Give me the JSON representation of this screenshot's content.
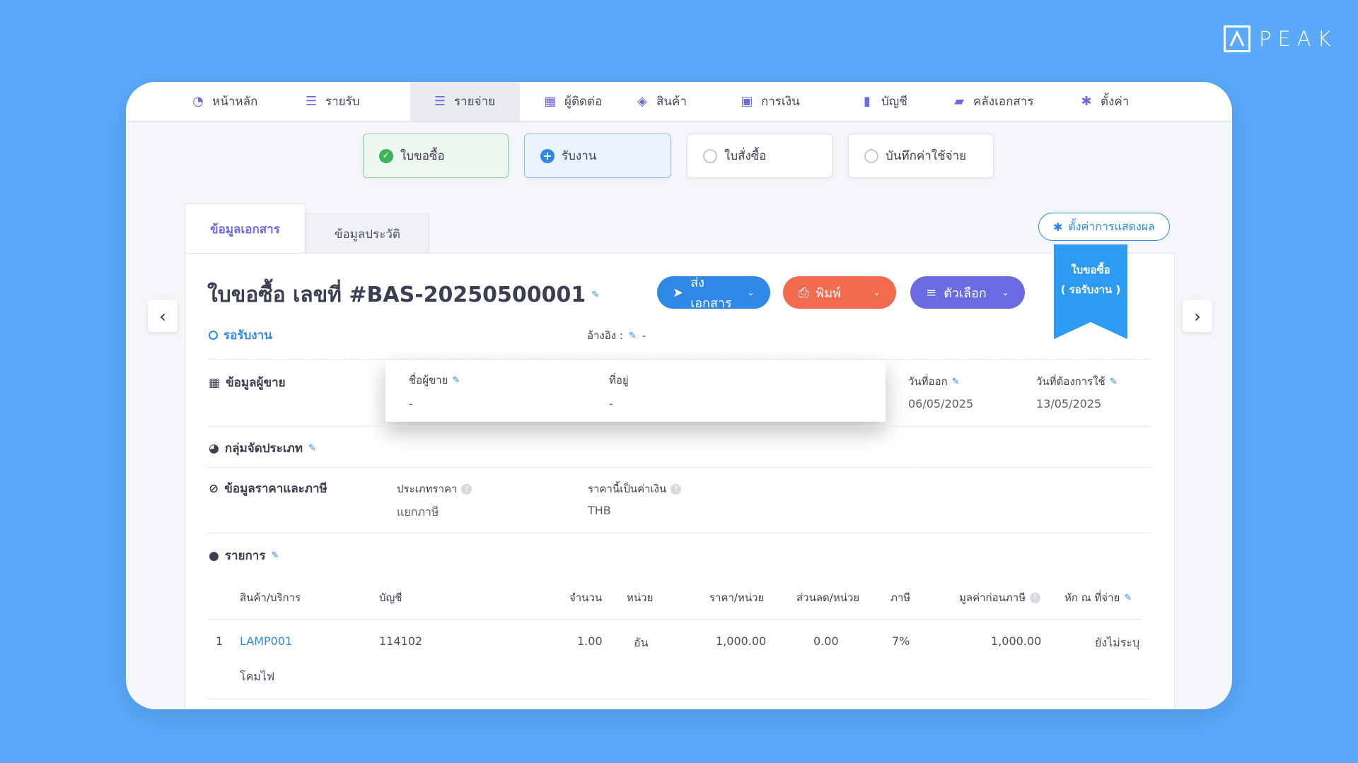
{
  "brand": {
    "logo_text": "PEAK"
  },
  "nav": [
    {
      "label": "หน้าหลัก",
      "icon": "dashboard-icon"
    },
    {
      "label": "รายรับ",
      "icon": "income-icon"
    },
    {
      "label": "รายจ่าย",
      "icon": "expense-icon",
      "active": true
    },
    {
      "label": "ผู้ติดต่อ",
      "icon": "contacts-icon"
    },
    {
      "label": "สินค้า",
      "icon": "box-icon"
    },
    {
      "label": "การเงิน",
      "icon": "money-icon"
    },
    {
      "label": "บัญชี",
      "icon": "book-icon"
    },
    {
      "label": "คลังเอกสาร",
      "icon": "folder-icon"
    },
    {
      "label": "ตั้งค่า",
      "icon": "gear-icon"
    }
  ],
  "steps": [
    {
      "label": "ใบขอซื้อ",
      "state": "done"
    },
    {
      "label": "รับงาน",
      "state": "current"
    },
    {
      "label": "ใบสั่งซื้อ",
      "state": "pending"
    },
    {
      "label": "บันทึกค่าใช้จ่าย",
      "state": "pending"
    }
  ],
  "tabs": {
    "doc_info": "ข้อมูลเอกสาร",
    "history": "ข้อมูลประวัติ"
  },
  "display_settings": "ตั้งค่าการแสดงผล",
  "badge": {
    "line1": "ใบขอซื้อ",
    "line2": "( รอรับงาน )"
  },
  "document": {
    "title": "ใบขอซื้อ เลขที่ #BAS-20250500001",
    "status": "รอรับงาน",
    "ref_label": "อ้างอิง :",
    "ref_value": "-"
  },
  "actions": {
    "send": "ส่งเอกสาร",
    "print": "พิมพ์",
    "options": "ตัวเลือก"
  },
  "vendor": {
    "section": "ข้อมูลผู้ขาย",
    "name_label": "ชื่อผู้ขาย",
    "name_value": "-",
    "address_label": "ที่อยู่",
    "address_value": "-",
    "issue_label": "วันที่ออก",
    "issue_value": "06/05/2025",
    "need_label": "วันที่ต้องการใช้",
    "need_value": "13/05/2025"
  },
  "category": {
    "section": "กลุ่มจัดประเภท"
  },
  "pricing": {
    "section": "ข้อมูลราคาและภาษี",
    "price_type_label": "ประเภทราคา",
    "price_type_value": "แยกภาษี",
    "currency_label": "ราคานี้เป็นค่าเงิน",
    "currency_value": "THB"
  },
  "items": {
    "section": "รายการ",
    "headers": {
      "product": "สินค้า/บริการ",
      "account": "บัญชี",
      "qty": "จำนวน",
      "unit": "หน่วย",
      "price": "ราคา/หน่วย",
      "discount": "ส่วนลด/หน่วย",
      "tax": "ภาษี",
      "pretax": "มูลค่าก่อนภาษี",
      "withhold": "หัก ณ ที่จ่าย"
    },
    "rows": [
      {
        "no": "1",
        "product": "LAMP001",
        "description": "โคมไฟ",
        "account": "114102",
        "qty": "1.00",
        "unit": "อัน",
        "price": "1,000.00",
        "discount": "0.00",
        "tax": "7%",
        "pretax": "1,000.00",
        "withhold": "ยังไม่ระบุ"
      }
    ]
  },
  "colors": {
    "background": "#5aa9fb",
    "primary": "#2e89e6",
    "print": "#f26b4e",
    "options": "#6b6ae0",
    "done": "#3ab35a"
  }
}
